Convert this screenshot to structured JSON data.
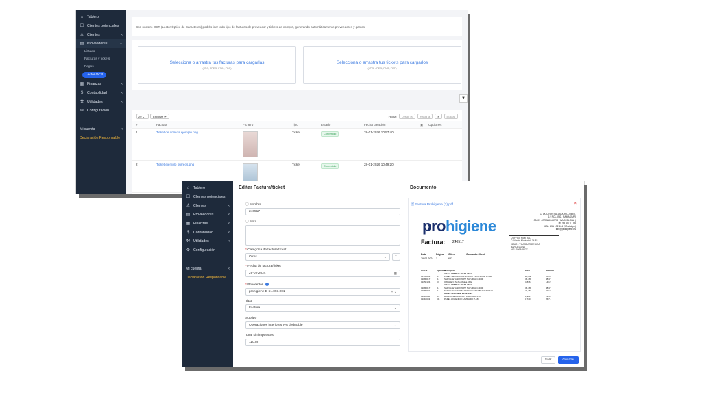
{
  "back": {
    "sidebar": {
      "items": [
        {
          "label": "Tablero",
          "icon": "home-icon"
        },
        {
          "label": "Clientes potenciales",
          "icon": "inbox-icon"
        },
        {
          "label": "Clientes",
          "icon": "users-icon"
        },
        {
          "label": "Proveedores",
          "icon": "wallet-icon"
        }
      ],
      "proveedores_sub": [
        "Listado",
        "Facturas y tickets",
        "Pagos"
      ],
      "active_pill": "Lector OCR",
      "items2": [
        {
          "label": "Finanzas"
        },
        {
          "label": "Contabilidad"
        },
        {
          "label": "Utilidades"
        },
        {
          "label": "Configuración"
        }
      ],
      "account": "Mi cuenta",
      "declaration": "Declaración Responsable"
    },
    "intro": "Con nuestro OCR (Lector Óptico de Caracteres) podrás leer todo tipo de facturas de proveedor y tickets de compra, generando automáticamente proveedores y gastos",
    "drop_invoices": {
      "title": "Selecciona o arrastra tus facturas para cargarlas",
      "sub": "(JPG, JPEG, PNG, PDF)"
    },
    "drop_tickets": {
      "title": "Selecciona o arrastra tus tickets para cargarlos",
      "sub": "(JPG, JPEG, PNG, PDF)"
    },
    "toolbar": {
      "page_size": "20",
      "export": "Exportar",
      "fecha": "Fecha:",
      "desde": "Desde la",
      "hasta": "Hasta la",
      "buscar": "Buscar"
    },
    "columns": [
      "#",
      "Factura",
      "Fichero",
      "Tipo",
      "Estado",
      "Fecha creación",
      "Opciones"
    ],
    "rows": [
      {
        "n": "1",
        "factura": "Ticket de comida ejemplo.png",
        "tipo": "Ticket",
        "estado": "Convertido",
        "fecha": "28-01-2026 10:57:40"
      },
      {
        "n": "2",
        "factura": "Ticket ejemplo burreos.png",
        "tipo": "Ticket",
        "estado": "Convertido",
        "fecha": "28-01-2026 10:49:20"
      }
    ]
  },
  "front": {
    "sidebar": {
      "items": [
        "Tablero",
        "Clientes potenciales",
        "Clientes",
        "Proveedores",
        "Finanzas",
        "Contabilidad",
        "Utilidades",
        "Configuración"
      ],
      "account": "Mi cuenta",
      "declaration": "Declaración Responsable"
    },
    "form": {
      "title": "Editar Factura/ticket",
      "nombre_label": "Nombre",
      "nombre_value": "240517",
      "nota_label": "Nota",
      "categoria_label": "Categoría de factura/ticket",
      "categoria_value": "Otros",
      "fecha_label": "Fecha de factura/ticket",
      "fecha_value": "29-02-2024",
      "proveedor_label": "Proveedor",
      "proveedor_value": "prohigiene B-61.093.001",
      "tipo_label": "Tipo",
      "tipo_value": "Factura",
      "subtipo_label": "Subtipo",
      "subtipo_value": "Operaciones interiores IVA deducible",
      "total_label": "Total sin impuestos",
      "total_value": "110,86"
    },
    "doc": {
      "title": "Documento",
      "file": "Factura Prohigiene (7).pdf",
      "logo_a": "pro",
      "logo_b": "higiene",
      "address": [
        "C/ DOCTOR SALVADOR LLOBET,",
        "12 POL. IND. RAMASSAR",
        "08401 - GRANOLLERS ( BARCELONA )",
        "Tel. 93 847 77 66",
        "MBL: 651 192 104 (WhatsApp)",
        "info@prohigiene.es"
      ],
      "factura_label": "Factura:",
      "factura_num": "240517",
      "client_box": [
        "COFFEE RIDE S.L.",
        "C/ Narcis Monturiol, 74-82",
        "",
        "08340 - VILASSAR DE MAR",
        "BARCELONA",
        "NIF: B56849027"
      ],
      "meta_headers": [
        "Data",
        "Página",
        "Client",
        "Comanda Client"
      ],
      "meta_values": [
        "29-02-2024",
        "1",
        "682",
        ""
      ],
      "line_headers": [
        "Article",
        "Quantitat",
        "Descripció",
        "Preu",
        "Subtotal"
      ],
      "lines": [
        {
          "sub": "Albarà 936         Data: 13-02-2024"
        },
        {
          "a": "04136001",
          "q": "1",
          "d": "PAPEL SECAMANOS NORDIC PLUS 40X40  P-500",
          "p": "20,148",
          "s": "20,16"
        },
        {
          "a": "02880017",
          "q": "1",
          "d": "SERVILLETA 20X20 PP NATURAL  C-4000",
          "p": "36,465",
          "s": "38,47"
        },
        {
          "a": "01050124",
          "q": "3",
          "d": "OXIGEEN 1M (botl/bolsa 5KG)",
          "p": "3,876",
          "s": "14,12"
        },
        {
          "sub": "Albarà 977         Data: 13-02-2024"
        },
        {
          "a": "02880017",
          "q": "1",
          "d": "SERVILLETA 20X20 PP NATURAL  C-4000",
          "p": "36,465",
          "s": "38,47"
        },
        {
          "a": "02880091",
          "q": "1",
          "d": "SERVILLETA KRAFT SERVIC 17X17 BLANCA 60UD",
          "p": "21,263",
          "s": "21,18"
        },
        {
          "sub": "Albarà 1133        Data: 28-02-2024"
        },
        {
          "a": "01140086",
          "q": "12",
          "d": "BOBINA SECAMANOS  LAMINADA  P-6",
          "p": "1,961",
          "s": "23,53"
        },
        {
          "a": "01140083",
          "q": "36",
          "d": "PAPEL HIGIENICO LAMINADO P-18",
          "p": "0,740",
          "s": "26,71"
        }
      ],
      "btn_exit": "Salir",
      "btn_save": "Guardar"
    }
  }
}
